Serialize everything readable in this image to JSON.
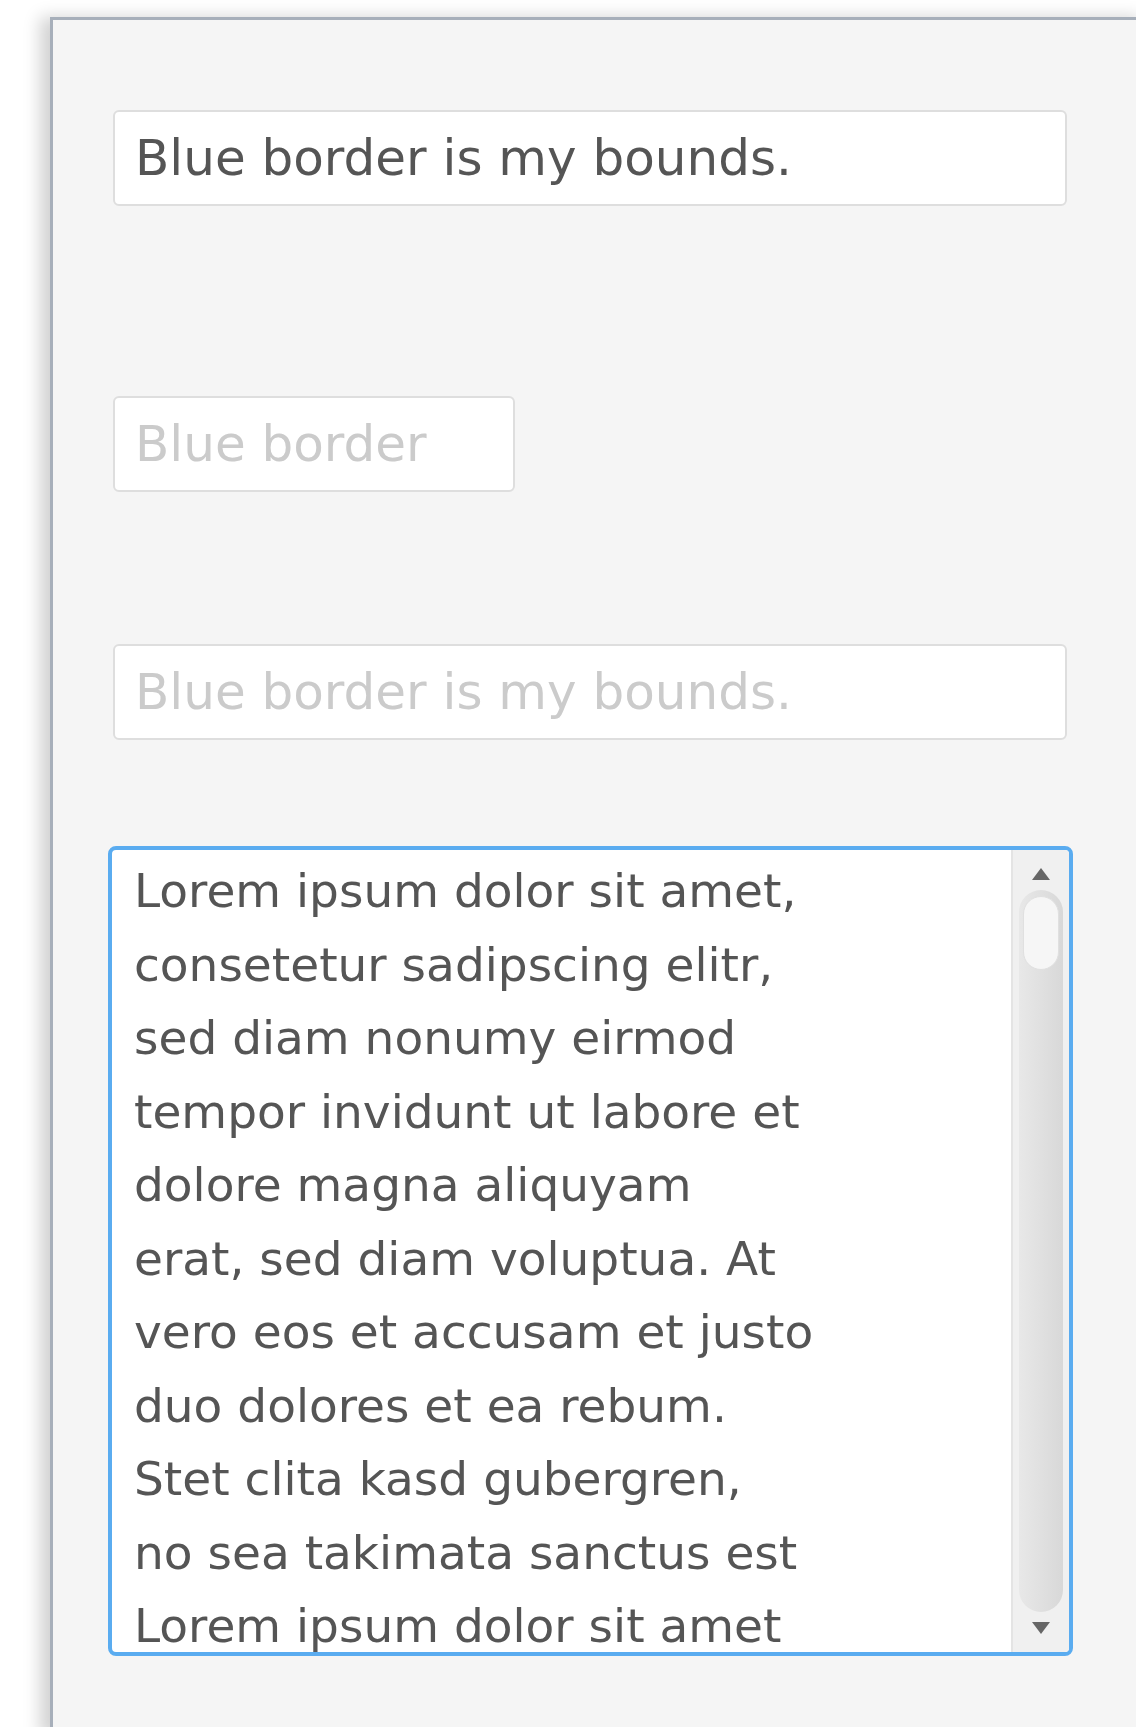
{
  "fields": [
    {
      "kind": "line",
      "value": "Blue border is my bounds.",
      "disabled": false,
      "wide": true
    },
    {
      "kind": "line",
      "value": "Blue border",
      "disabled": true,
      "wide": false
    },
    {
      "kind": "line",
      "value": "Blue border is my bounds.",
      "disabled": true,
      "wide": true
    },
    {
      "kind": "area",
      "value": "Lorem ipsum dolor sit amet,\nconsetetur sadipscing elitr,\nsed diam nonumy eirmod\ntempor invidunt ut labore et\ndolore magna aliquyam\nerat, sed diam voluptua. At\nvero eos et accusam et justo\nduo dolores et ea rebum.\nStet clita kasd gubergren,\nno sea takimata sanctus est\nLorem ipsum dolor sit amet",
      "disabled": false,
      "focused": true
    }
  ]
}
